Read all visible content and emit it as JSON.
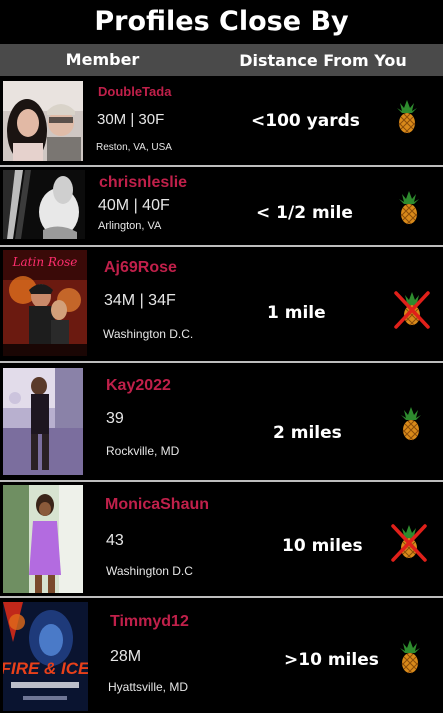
{
  "page": {
    "title": "Profiles Close By"
  },
  "table": {
    "header_member": "Member",
    "header_distance": "Distance From You"
  },
  "profiles": [
    {
      "username": "DoubleTada",
      "ages": "30M | 30F",
      "location": "Reston, VA, USA",
      "distance": "<100 yards",
      "swinger_icon": "pineapple-icon",
      "icon_crossed": false
    },
    {
      "username": "chrisnleslie",
      "ages": "40M | 40F",
      "location": "Arlington, VA",
      "distance": "< 1/2 mile",
      "swinger_icon": "pineapple-icon",
      "icon_crossed": false
    },
    {
      "username": "Aj69Rose",
      "ages": "34M | 34F",
      "location": "Washington D.C.",
      "distance": "1 mile",
      "swinger_icon": "pineapple-icon",
      "icon_crossed": true
    },
    {
      "username": "Kay2022",
      "ages": "39",
      "location": "Rockville, MD",
      "distance": "2 miles",
      "swinger_icon": "pineapple-icon",
      "icon_crossed": false
    },
    {
      "username": "MonicaShaun",
      "ages": "43",
      "location": "Washington D.C",
      "distance": "10 miles",
      "swinger_icon": "pineapple-icon",
      "icon_crossed": true
    },
    {
      "username": "Timmyd12",
      "ages": "28M",
      "location": "Hyattsville, MD",
      "distance": ">10 miles",
      "swinger_icon": "pineapple-icon",
      "icon_crossed": false
    }
  ],
  "photos": [
    {
      "name": "profile-photo-doubletada"
    },
    {
      "name": "profile-photo-chrisnleslie"
    },
    {
      "name": "profile-photo-aj69rose",
      "caption": "Latin Rose"
    },
    {
      "name": "profile-photo-kay2022"
    },
    {
      "name": "profile-photo-monicashaun"
    },
    {
      "name": "profile-photo-timmyd12",
      "caption": "FIRE & ICE"
    }
  ],
  "colors": {
    "background": "#000000",
    "header_bar": "#4a4a4a",
    "username": "#c0204a",
    "divider": "#bdbdbd",
    "cross": "#e0201a"
  }
}
